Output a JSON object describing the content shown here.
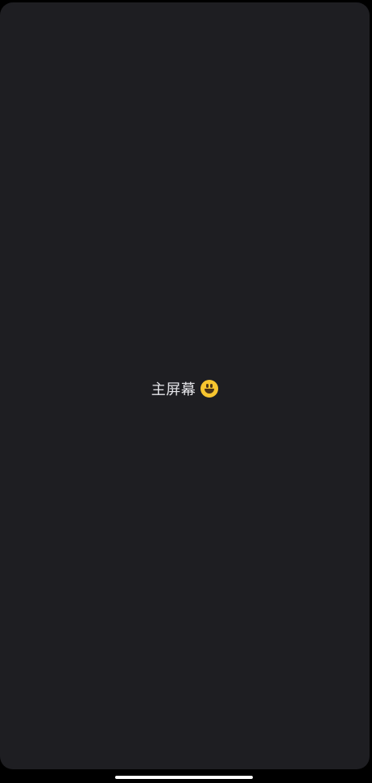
{
  "screen": {
    "title": "主屏幕"
  },
  "icons": {
    "face": "smiling-face-icon"
  },
  "colors": {
    "background": "#1e1e22",
    "text": "#e6e6ea",
    "emoji": "#f7c52f",
    "home_indicator": "#ffffff"
  }
}
